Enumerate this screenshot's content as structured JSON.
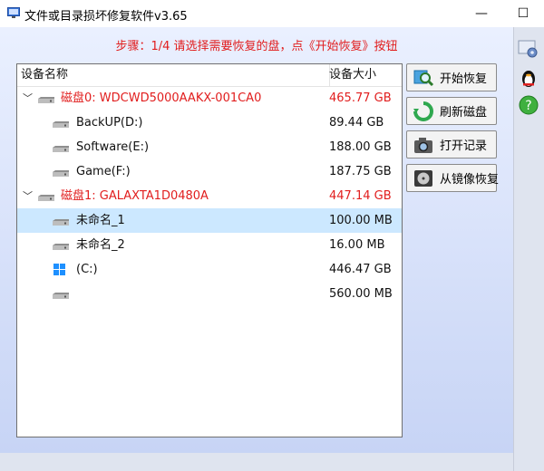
{
  "window": {
    "title": "文件或目录损坏修复软件v3.65",
    "minimize_glyph": "—",
    "maximize_glyph": "☐",
    "close_glyph": "✕"
  },
  "hint": "步骤：1/4 请选择需要恢复的盘，点《开始恢复》按钮",
  "list": {
    "headers": {
      "name": "设备名称",
      "size": "设备大小"
    },
    "rows": [
      {
        "name": "磁盘0: WDCWD5000AAKX-001CA0",
        "size": "465.77 GB"
      },
      {
        "name": "BackUP(D:)",
        "size": "89.44 GB"
      },
      {
        "name": "Software(E:)",
        "size": "188.00 GB"
      },
      {
        "name": "Game(F:)",
        "size": "187.75 GB"
      },
      {
        "name": "磁盘1: GALAXTA1D0480A",
        "size": "447.14 GB"
      },
      {
        "name": "未命名_1",
        "size": "100.00 MB"
      },
      {
        "name": "未命名_2",
        "size": "16.00 MB"
      },
      {
        "name": "(C:)",
        "size": "446.47 GB"
      },
      {
        "name": "",
        "size": "560.00 MB"
      }
    ],
    "expand_glyph": "﹀"
  },
  "buttons": {
    "start": "开始恢复",
    "refresh": "刷新磁盘",
    "open_log": "打开记录",
    "from_image": "从镜像恢复"
  },
  "colors": {
    "accent_red": "#e11d1d",
    "selection": "#cce8ff"
  }
}
